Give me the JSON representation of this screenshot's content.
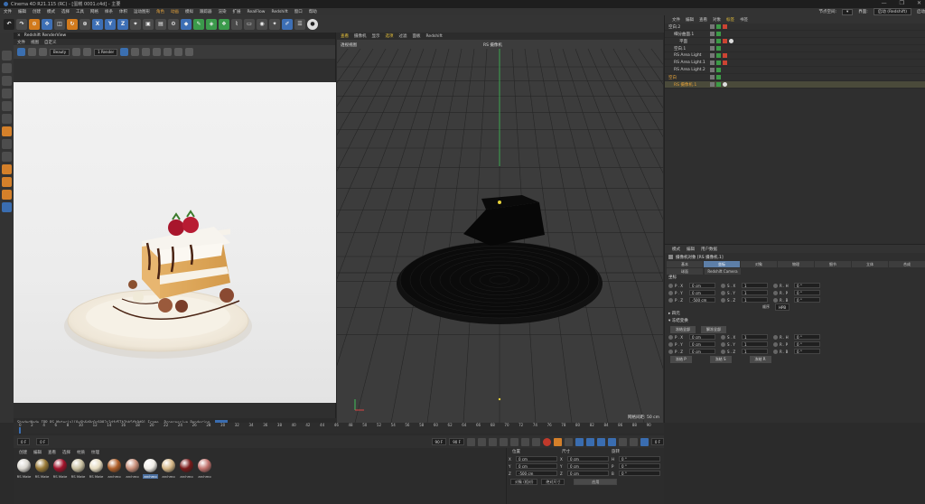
{
  "window": {
    "title": "Cinema 4D R21.115 (RC) - [蛋糕 0001.c4d] - 主要",
    "controls": [
      "—",
      "❐",
      "✕"
    ]
  },
  "menubar": {
    "items": [
      "文件",
      "编辑",
      "创建",
      "模式",
      "选择",
      "工具",
      "网格",
      "样条",
      "体积",
      "运动图形",
      "角色",
      "动画",
      "模拟",
      "跟踪器",
      "渲染",
      "扩展",
      "RealFlow",
      "Redshift",
      "窗口",
      "帮助"
    ],
    "orange_items": [
      "角色",
      "动画"
    ],
    "right_label": "节点空间:",
    "layout_label": "界面:",
    "layout_value": "启动 (Redshift)",
    "extra": "启动"
  },
  "toolbar": {
    "xyz": [
      "X",
      "Y",
      "Z"
    ]
  },
  "render_view": {
    "title": "Redshift RenderView",
    "menu": [
      "文件",
      "视图",
      "自定义"
    ],
    "mode": "Beauty",
    "zoom": "1 Render",
    "status_left": "ShaderNode IPR RS Material[0x6b6d0c0c6082c3dfd57b2bb5fb9d9] Frame",
    "status_mid": "Progressive Rendering"
  },
  "viewport": {
    "menu": [
      "查看",
      "摄像机",
      "显示",
      "选项",
      "过滤",
      "面板",
      "Redshift"
    ],
    "highlight": [
      "查看",
      "选项"
    ],
    "label": "透视视图",
    "camera": "RS 摄像机",
    "grid": "网格间距: 50 cm"
  },
  "object_manager": {
    "menu": [
      "文件",
      "编辑",
      "查看",
      "对象",
      "标签",
      "书签"
    ],
    "highlight": "标签",
    "objects": [
      {
        "name": "空白.2",
        "indent": 0,
        "tags": [
          "g",
          "r"
        ]
      },
      {
        "name": "细分曲面.1",
        "indent": 1,
        "tags": [
          "g"
        ]
      },
      {
        "name": "平面",
        "indent": 2,
        "tags": [
          "g",
          "r",
          "w"
        ]
      },
      {
        "name": "空白.1",
        "indent": 1,
        "tags": [
          "g"
        ]
      },
      {
        "name": "RS Area Light",
        "indent": 1,
        "tags": [
          "g",
          "r"
        ]
      },
      {
        "name": "RS Area Light.1",
        "indent": 1,
        "tags": [
          "g",
          "r"
        ]
      },
      {
        "name": "RS Area Light.2",
        "indent": 1,
        "tags": [
          "g"
        ]
      },
      {
        "name": "空白",
        "indent": 0,
        "tags": [
          "g"
        ],
        "orange": true
      },
      {
        "name": "RS 摄像机.1",
        "indent": 1,
        "tags": [
          "g",
          "w"
        ],
        "orange": true,
        "selected": true
      }
    ]
  },
  "attribute_manager": {
    "menu": [
      "模式",
      "编辑",
      "用户数据"
    ],
    "title": "摄像机对象 [RS 摄像机.1]",
    "tabs": [
      "基本",
      "坐标",
      "对象",
      "物理",
      "细节",
      "立体",
      "合成"
    ],
    "active_tab": "坐标",
    "subtabs": [
      "球面",
      "Redshift Camera"
    ],
    "section_coord": "坐标",
    "coords": [
      [
        {
          "l": "P . X",
          "v": "0 cm"
        },
        {
          "l": "S . X",
          "v": "1"
        },
        {
          "l": "R . H",
          "v": "0 °"
        }
      ],
      [
        {
          "l": "P . Y",
          "v": "0 cm"
        },
        {
          "l": "S . Y",
          "v": "1"
        },
        {
          "l": "R . P",
          "v": "0 °"
        }
      ],
      [
        {
          "l": "P . Z",
          "v": "-500 cm"
        },
        {
          "l": "S . Z",
          "v": "1"
        },
        {
          "l": "R . B",
          "v": "0 °"
        }
      ]
    ],
    "order_label": "顺序",
    "order_value": "HPB",
    "section_quat": "四元",
    "section_freeze": "冻结变换",
    "freeze_buttons": [
      "冻结全部",
      "解冻全部"
    ],
    "frozen": [
      [
        {
          "l": "P . X",
          "v": "0 cm"
        },
        {
          "l": "S . X",
          "v": "1"
        },
        {
          "l": "R . H",
          "v": "0 °"
        }
      ],
      [
        {
          "l": "P . Y",
          "v": "0 cm"
        },
        {
          "l": "S . Y",
          "v": "1"
        },
        {
          "l": "R . P",
          "v": "0 °"
        }
      ],
      [
        {
          "l": "P . Z",
          "v": "0 cm"
        },
        {
          "l": "S . Z",
          "v": "1"
        },
        {
          "l": "R . B",
          "v": "0 °"
        }
      ]
    ],
    "freeze_each": [
      "冻结 P",
      "冻结 S",
      "冻结 R"
    ]
  },
  "timeline": {
    "ticks": [
      "0",
      "2",
      "4",
      "6",
      "8",
      "10",
      "12",
      "14",
      "16",
      "18",
      "20",
      "22",
      "24",
      "26",
      "28",
      "30",
      "32",
      "34",
      "36",
      "38",
      "40",
      "42",
      "44",
      "46",
      "48",
      "50",
      "52",
      "54",
      "56",
      "58",
      "60",
      "62",
      "64",
      "66",
      "68",
      "70",
      "72",
      "74",
      "76",
      "78",
      "80",
      "82",
      "84",
      "86",
      "88",
      "90"
    ],
    "current": "0 F",
    "start": "0 F",
    "end": "90 F",
    "end2": "90 F",
    "frame_right": "0 F"
  },
  "materials": {
    "menu": [
      "创建",
      "编辑",
      "查看",
      "选择",
      "材质",
      "纹理"
    ],
    "items": [
      {
        "name": "RS Mate",
        "color": "#d9d6cf"
      },
      {
        "name": "RS Mate",
        "color": "#9a7a36"
      },
      {
        "name": "RS Mate",
        "color": "#a3122a"
      },
      {
        "name": "RS Mate",
        "color": "#c9c0a0"
      },
      {
        "name": "RS Mate",
        "color": "#e6dcc0"
      },
      {
        "name": "archmo",
        "color": "#b0602a"
      },
      {
        "name": "archmo",
        "color": "#c98f7a"
      },
      {
        "name": "archmo",
        "color": "#f0ede6",
        "selected": true
      },
      {
        "name": "archmo",
        "color": "#d6b888"
      },
      {
        "name": "archmo",
        "color": "#7a1a1a"
      },
      {
        "name": "archmo",
        "color": "#c2736e"
      }
    ]
  },
  "coordinates": {
    "headers": [
      "位置",
      "尺寸",
      "旋转"
    ],
    "rows": [
      {
        "a": "X",
        "av": "0 cm",
        "b": "X",
        "bv": "0 cm",
        "c": "H",
        "cv": "0 °"
      },
      {
        "a": "Y",
        "av": "0 cm",
        "b": "Y",
        "bv": "0 cm",
        "c": "P",
        "cv": "0 °"
      },
      {
        "a": "Z",
        "av": "-500 cm",
        "b": "Z",
        "bv": "0 cm",
        "c": "B",
        "cv": "0 °"
      }
    ],
    "mode1": "对象 (相对)",
    "mode2": "绝对尺寸",
    "apply": "应用"
  }
}
